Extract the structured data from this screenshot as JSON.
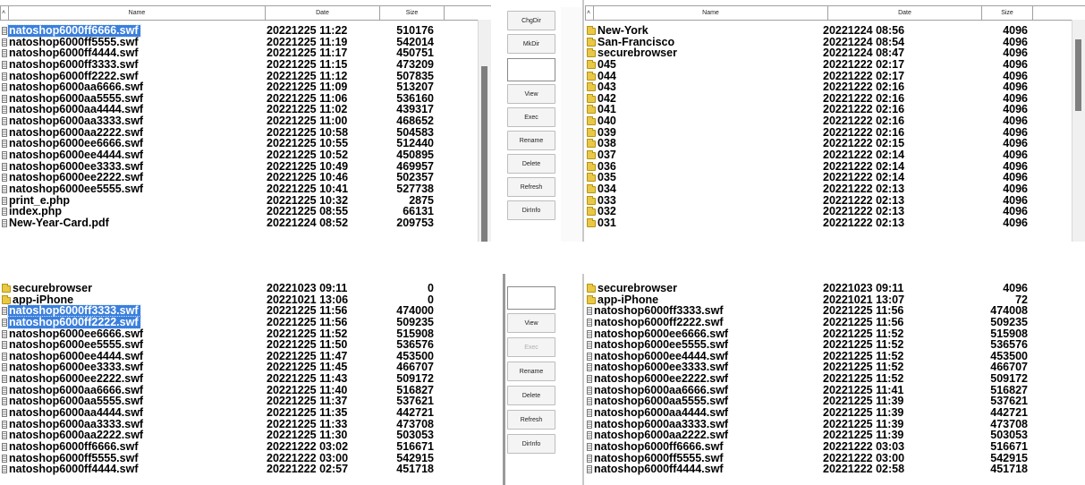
{
  "columns": {
    "name": "Name",
    "date": "Date",
    "size": "Size"
  },
  "buttons_top": [
    "ChgDir",
    "MkDir",
    "View",
    "Exec",
    "Rename",
    "Delete",
    "Refresh",
    "DirInfo"
  ],
  "buttons_bottom": [
    "View",
    "Exec",
    "Rename",
    "Delete",
    "Refresh",
    "DirInfo"
  ],
  "top_left_rows": [
    {
      "icon": "file-icon",
      "name": "natoshop6000ff6666.swf",
      "date": "20221225 11:22",
      "size": "510176",
      "selected": true
    },
    {
      "icon": "file-icon",
      "name": "natoshop6000ff5555.swf",
      "date": "20221225 11:19",
      "size": "542014"
    },
    {
      "icon": "file-icon",
      "name": "natoshop6000ff4444.swf",
      "date": "20221225 11:17",
      "size": "450751"
    },
    {
      "icon": "file-icon",
      "name": "natoshop6000ff3333.swf",
      "date": "20221225 11:15",
      "size": "473209"
    },
    {
      "icon": "file-icon",
      "name": "natoshop6000ff2222.swf",
      "date": "20221225 11:12",
      "size": "507835"
    },
    {
      "icon": "file-icon",
      "name": "natoshop6000aa6666.swf",
      "date": "20221225 11:09",
      "size": "513207"
    },
    {
      "icon": "file-icon",
      "name": "natoshop6000aa5555.swf",
      "date": "20221225 11:06",
      "size": "536160"
    },
    {
      "icon": "file-icon",
      "name": "natoshop6000aa4444.swf",
      "date": "20221225 11:02",
      "size": "439317"
    },
    {
      "icon": "file-icon",
      "name": "natoshop6000aa3333.swf",
      "date": "20221225 11:00",
      "size": "468652"
    },
    {
      "icon": "file-icon",
      "name": "natoshop6000aa2222.swf",
      "date": "20221225 10:58",
      "size": "504583"
    },
    {
      "icon": "file-icon",
      "name": "natoshop6000ee6666.swf",
      "date": "20221225 10:55",
      "size": "512440"
    },
    {
      "icon": "file-icon",
      "name": "natoshop6000ee4444.swf",
      "date": "20221225 10:52",
      "size": "450895"
    },
    {
      "icon": "file-icon",
      "name": "natoshop6000ee3333.swf",
      "date": "20221225 10:49",
      "size": "469957"
    },
    {
      "icon": "file-icon",
      "name": "natoshop6000ee2222.swf",
      "date": "20221225 10:46",
      "size": "502357"
    },
    {
      "icon": "file-icon",
      "name": "natoshop6000ee5555.swf",
      "date": "20221225 10:41",
      "size": "527738"
    },
    {
      "icon": "file-icon",
      "name": "print_e.php",
      "date": "20221225 10:32",
      "size": "2875"
    },
    {
      "icon": "file-icon",
      "name": "index.php",
      "date": "20221225 08:55",
      "size": "66131"
    },
    {
      "icon": "file-icon",
      "name": "New-Year-Card.pdf",
      "date": "20221224 08:52",
      "size": "209753"
    }
  ],
  "top_right_rows": [
    {
      "icon": "folder-icon",
      "name": "New-York",
      "date": "20221224 08:56",
      "size": "4096"
    },
    {
      "icon": "folder-icon",
      "name": "San-Francisco",
      "date": "20221224 08:54",
      "size": "4096"
    },
    {
      "icon": "folder-icon",
      "name": "securebrowser",
      "date": "20221224 08:47",
      "size": "4096"
    },
    {
      "icon": "folder-icon",
      "name": "045",
      "date": "20221222 02:17",
      "size": "4096"
    },
    {
      "icon": "folder-icon",
      "name": "044",
      "date": "20221222 02:17",
      "size": "4096"
    },
    {
      "icon": "folder-icon",
      "name": "043",
      "date": "20221222 02:16",
      "size": "4096"
    },
    {
      "icon": "folder-icon",
      "name": "042",
      "date": "20221222 02:16",
      "size": "4096"
    },
    {
      "icon": "folder-icon",
      "name": "041",
      "date": "20221222 02:16",
      "size": "4096"
    },
    {
      "icon": "folder-icon",
      "name": "040",
      "date": "20221222 02:16",
      "size": "4096"
    },
    {
      "icon": "folder-icon",
      "name": "039",
      "date": "20221222 02:16",
      "size": "4096"
    },
    {
      "icon": "folder-icon",
      "name": "038",
      "date": "20221222 02:15",
      "size": "4096"
    },
    {
      "icon": "folder-icon",
      "name": "037",
      "date": "20221222 02:14",
      "size": "4096"
    },
    {
      "icon": "folder-icon",
      "name": "036",
      "date": "20221222 02:14",
      "size": "4096"
    },
    {
      "icon": "folder-icon",
      "name": "035",
      "date": "20221222 02:14",
      "size": "4096"
    },
    {
      "icon": "folder-icon",
      "name": "034",
      "date": "20221222 02:13",
      "size": "4096"
    },
    {
      "icon": "folder-icon",
      "name": "033",
      "date": "20221222 02:13",
      "size": "4096"
    },
    {
      "icon": "folder-icon",
      "name": "032",
      "date": "20221222 02:13",
      "size": "4096"
    },
    {
      "icon": "folder-icon",
      "name": "031",
      "date": "20221222 02:13",
      "size": "4096"
    }
  ],
  "bottom_left_rows": [
    {
      "icon": "folder-icon",
      "name": "securebrowser",
      "date": "20221023 09:11",
      "size": "0"
    },
    {
      "icon": "folder-icon",
      "name": "app-iPhone",
      "date": "20221021 13:06",
      "size": "0"
    },
    {
      "icon": "file-icon",
      "name": "natoshop6000ff3333.swf",
      "date": "20221225 11:56",
      "size": "474000",
      "selected": true
    },
    {
      "icon": "file-icon",
      "name": "natoshop6000ff2222.swf",
      "date": "20221225 11:56",
      "size": "509235",
      "selected": true
    },
    {
      "icon": "file-icon",
      "name": "natoshop6000ee6666.swf",
      "date": "20221225 11:52",
      "size": "515908"
    },
    {
      "icon": "file-icon",
      "name": "natoshop6000ee5555.swf",
      "date": "20221225 11:50",
      "size": "536576"
    },
    {
      "icon": "file-icon",
      "name": "natoshop6000ee4444.swf",
      "date": "20221225 11:47",
      "size": "453500"
    },
    {
      "icon": "file-icon",
      "name": "natoshop6000ee3333.swf",
      "date": "20221225 11:45",
      "size": "466707"
    },
    {
      "icon": "file-icon",
      "name": "natoshop6000ee2222.swf",
      "date": "20221225 11:43",
      "size": "509172"
    },
    {
      "icon": "file-icon",
      "name": "natoshop6000aa6666.swf",
      "date": "20221225 11:40",
      "size": "516827"
    },
    {
      "icon": "file-icon",
      "name": "natoshop6000aa5555.swf",
      "date": "20221225 11:37",
      "size": "537621"
    },
    {
      "icon": "file-icon",
      "name": "natoshop6000aa4444.swf",
      "date": "20221225 11:35",
      "size": "442721"
    },
    {
      "icon": "file-icon",
      "name": "natoshop6000aa3333.swf",
      "date": "20221225 11:33",
      "size": "473708"
    },
    {
      "icon": "file-icon",
      "name": "natoshop6000aa2222.swf",
      "date": "20221225 11:30",
      "size": "503053"
    },
    {
      "icon": "file-icon",
      "name": "natoshop6000ff6666.swf",
      "date": "20221222 03:02",
      "size": "516671"
    },
    {
      "icon": "file-icon",
      "name": "natoshop6000ff5555.swf",
      "date": "20221222 03:00",
      "size": "542915"
    },
    {
      "icon": "file-icon",
      "name": "natoshop6000ff4444.swf",
      "date": "20221222 02:57",
      "size": "451718"
    }
  ],
  "bottom_right_rows": [
    {
      "icon": "folder-icon",
      "name": "securebrowser",
      "date": "20221023 09:11",
      "size": "4096"
    },
    {
      "icon": "folder-icon",
      "name": "app-iPhone",
      "date": "20221021 13:07",
      "size": "72"
    },
    {
      "icon": "file-icon",
      "name": "natoshop6000ff3333.swf",
      "date": "20221225 11:56",
      "size": "474008"
    },
    {
      "icon": "file-icon",
      "name": "natoshop6000ff2222.swf",
      "date": "20221225 11:56",
      "size": "509235"
    },
    {
      "icon": "file-icon",
      "name": "natoshop6000ee6666.swf",
      "date": "20221225 11:52",
      "size": "515908"
    },
    {
      "icon": "file-icon",
      "name": "natoshop6000ee5555.swf",
      "date": "20221225 11:52",
      "size": "536576"
    },
    {
      "icon": "file-icon",
      "name": "natoshop6000ee4444.swf",
      "date": "20221225 11:52",
      "size": "453500"
    },
    {
      "icon": "file-icon",
      "name": "natoshop6000ee3333.swf",
      "date": "20221225 11:52",
      "size": "466707"
    },
    {
      "icon": "file-icon",
      "name": "natoshop6000ee2222.swf",
      "date": "20221225 11:52",
      "size": "509172"
    },
    {
      "icon": "file-icon",
      "name": "natoshop6000aa6666.swf",
      "date": "20221225 11:41",
      "size": "516827"
    },
    {
      "icon": "file-icon",
      "name": "natoshop6000aa5555.swf",
      "date": "20221225 11:39",
      "size": "537621"
    },
    {
      "icon": "file-icon",
      "name": "natoshop6000aa4444.swf",
      "date": "20221225 11:39",
      "size": "442721"
    },
    {
      "icon": "file-icon",
      "name": "natoshop6000aa3333.swf",
      "date": "20221225 11:39",
      "size": "473708"
    },
    {
      "icon": "file-icon",
      "name": "natoshop6000aa2222.swf",
      "date": "20221225 11:39",
      "size": "503053"
    },
    {
      "icon": "file-icon",
      "name": "natoshop6000ff6666.swf",
      "date": "20221222 03:03",
      "size": "516671"
    },
    {
      "icon": "file-icon",
      "name": "natoshop6000ff5555.swf",
      "date": "20221222 03:00",
      "size": "542915"
    },
    {
      "icon": "file-icon",
      "name": "natoshop6000ff4444.swf",
      "date": "20221222 02:58",
      "size": "451718"
    }
  ],
  "colors": {
    "selection": "#3a7fdc",
    "folder": "#e8c846",
    "scroll_thumb": "#7f7f7f"
  }
}
